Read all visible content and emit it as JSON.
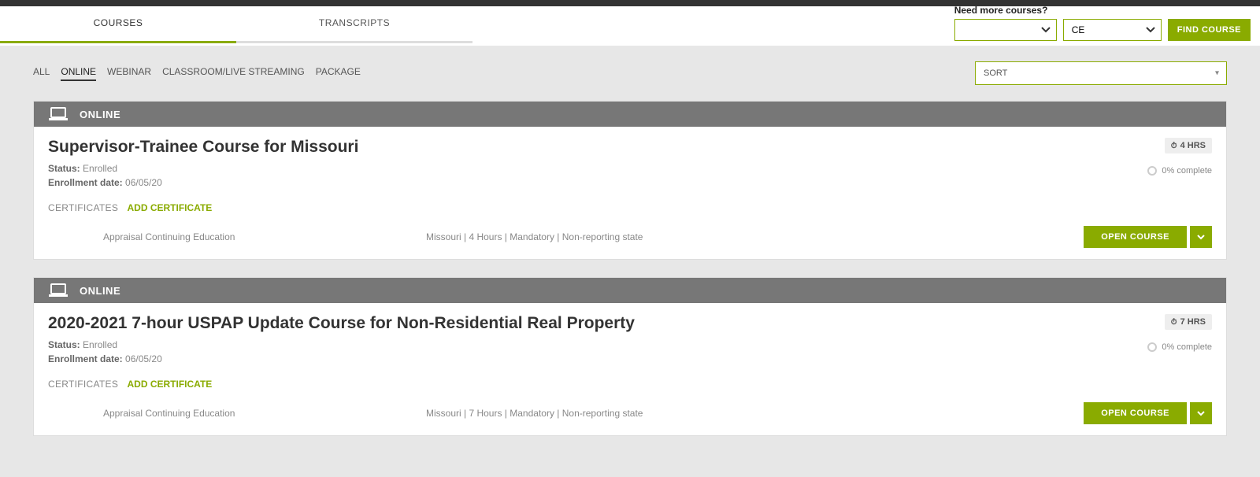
{
  "tabs": {
    "courses": "COURSES",
    "transcripts": "TRANSCRIPTS"
  },
  "finder": {
    "label": "Need more courses?",
    "ce": "CE",
    "find": "FIND COURSE"
  },
  "filters": {
    "all": "ALL",
    "online": "ONLINE",
    "webinar": "WEBINAR",
    "classroom": "CLASSROOM/LIVE STREAMING",
    "package": "PACKAGE"
  },
  "sort": {
    "placeholder": "SORT"
  },
  "labels": {
    "online_header": "ONLINE",
    "status": "Status:",
    "enroll_date": "Enrollment date:",
    "certificates": "CERTIFICATES",
    "add_cert": "ADD CERTIFICATE",
    "open_course": "OPEN COURSE"
  },
  "courses": [
    {
      "title": "Supervisor-Trainee Course for Missouri",
      "status": "Enrolled",
      "enroll_date": "06/05/20",
      "hours_badge": "4 HRS",
      "progress": "0% complete",
      "cert_type": "Appraisal Continuing Education",
      "detail": "Missouri | 4 Hours | Mandatory | Non-reporting state"
    },
    {
      "title": "2020-2021 7-hour USPAP Update Course for Non-Residential Real Property",
      "status": "Enrolled",
      "enroll_date": "06/05/20",
      "hours_badge": "7 HRS",
      "progress": "0% complete",
      "cert_type": "Appraisal Continuing Education",
      "detail": "Missouri | 7 Hours | Mandatory | Non-reporting state"
    }
  ]
}
